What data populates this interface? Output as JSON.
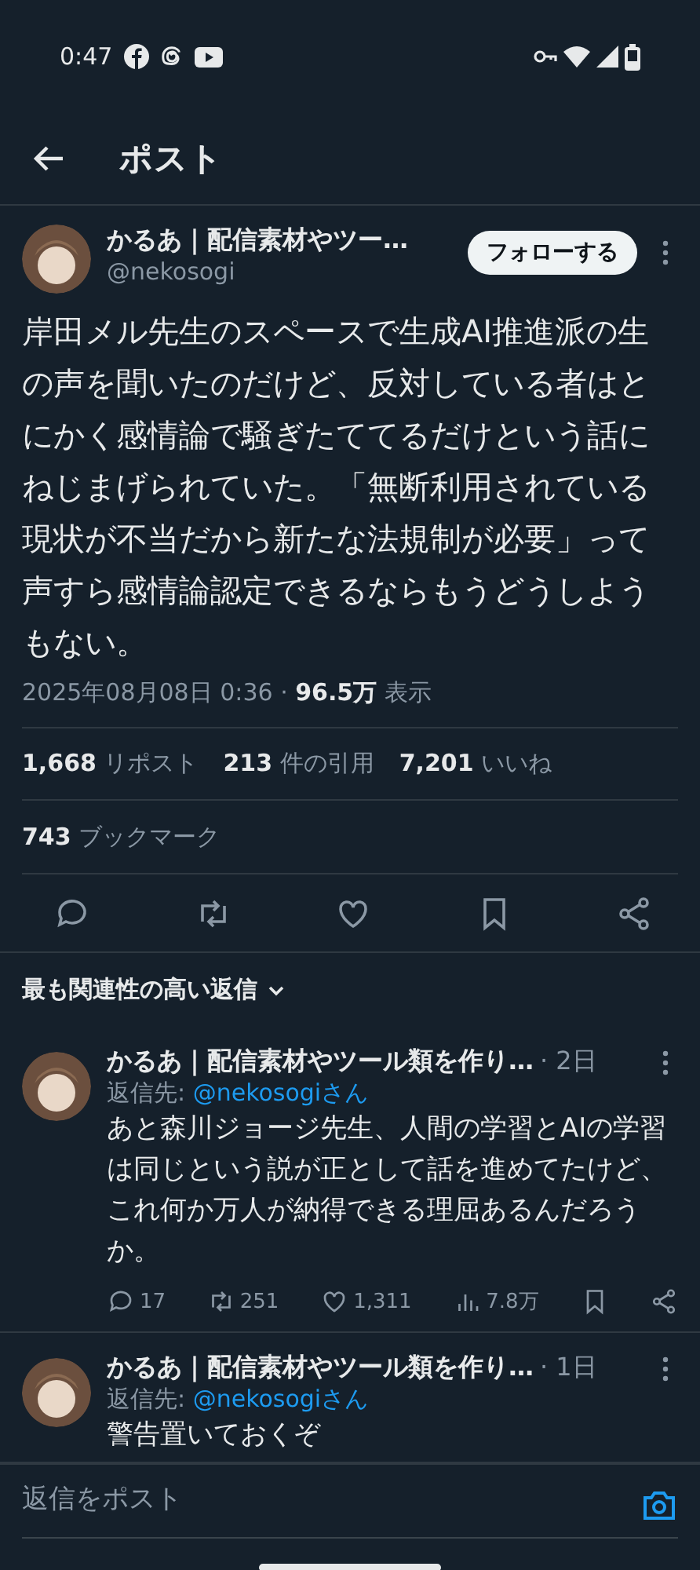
{
  "status_bar": {
    "time": "0:47"
  },
  "header": {
    "title": "ポスト"
  },
  "post": {
    "author_name": "かるあ｜配信素材やツー…",
    "handle": "@nekosogi",
    "follow_button": "フォローする",
    "body": "岸田メル先生のスペースで生成AI推進派の生の声を聞いたのだけど、反対している者はとにかく感情論で騒ぎたててるだけという話にねじまげられていた。「無断利用されている現状が不当だから新たな法規制が必要」って声すら感情論認定できるならもうどうしようもない。",
    "meta": "2025年08月08日 0:36 · **96.5万** 表示",
    "stats": [
      "**1,668** リポスト",
      "**213** 件の引用",
      "**7,201** いいね"
    ],
    "bookmarks": "**743** ブックマーク",
    "actions": [
      {
        "kind": "reply"
      },
      {
        "kind": "repost"
      },
      {
        "kind": "like"
      },
      {
        "kind": "bookmark"
      },
      {
        "kind": "share"
      }
    ]
  },
  "replies_sort": {
    "label": "最も関連性の高い返信"
  },
  "replies": [
    {
      "author_name": "かるあ｜配信素材やツール類を作り…",
      "time": "· 2日",
      "reply_to_label": "返信先:",
      "reply_to": "@nekosogiさん",
      "text": "あと森川ジョージ先生、人間の学習とAIの学習は同じという説が正として話を進めてたけど、これ何か万人が納得できる理屈あるんだろうか。",
      "actions": [
        {
          "kind": "reply",
          "count": "17"
        },
        {
          "kind": "repost",
          "count": "251"
        },
        {
          "kind": "like",
          "count": "1,311"
        },
        {
          "kind": "views",
          "count": "7.8万"
        },
        {
          "kind": "bookmark"
        },
        {
          "kind": "share"
        }
      ]
    },
    {
      "author_name": "かるあ｜配信素材やツール類を作り…",
      "time": "· 1日",
      "reply_to_label": "返信先:",
      "reply_to": "@nekosogiさん",
      "text": "警告置いておくぞ"
    }
  ],
  "composer": {
    "placeholder": "返信をポスト"
  }
}
